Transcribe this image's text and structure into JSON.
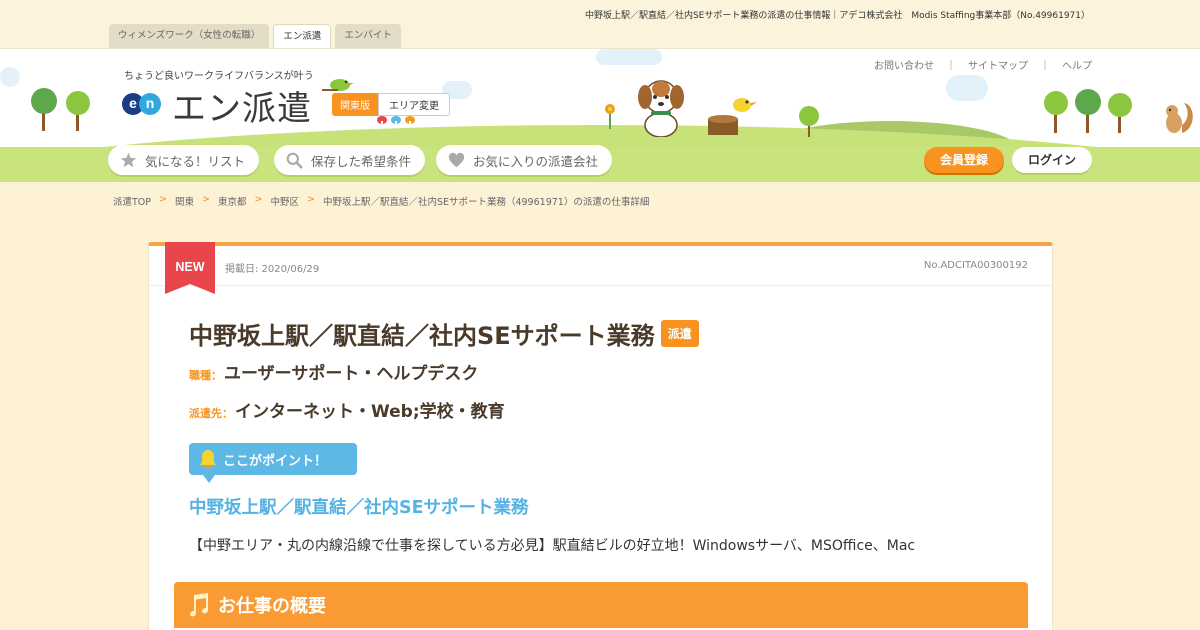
{
  "page_title": "中野坂上駅／駅直結／社内SEサポート業務の派遣の仕事情報｜アデコ株式会社　Modis Staffing事業本部（No.49961971）",
  "tabs": [
    {
      "label": "ウィメンズワーク（女性の転職）",
      "active": false
    },
    {
      "label": "エン派遣",
      "active": true
    },
    {
      "label": "エンバイト",
      "active": false
    }
  ],
  "header": {
    "tagline": "ちょうど良いワークライフバランスが叶う",
    "logo_en": [
      "e",
      "n"
    ],
    "logo_text": "エン派遣",
    "region_badge": "関東版",
    "region_change": "エリア変更",
    "util_links": [
      "お問い合わせ",
      "｜",
      "サイトマップ",
      "｜",
      "ヘルプ"
    ],
    "nav": [
      {
        "label": "気になる！リスト",
        "icon": "star-icon"
      },
      {
        "label": "保存した希望条件",
        "icon": "search-icon"
      },
      {
        "label": "お気に入りの派遣会社",
        "icon": "heart-icon"
      }
    ],
    "register_label": "会員登録",
    "login_label": "ログイン"
  },
  "breadcrumb": [
    "派遣TOP",
    "関東",
    "東京都",
    "中野区",
    "中野坂上駅／駅直結／社内SEサポート業務（49961971）の派遣の仕事詳細"
  ],
  "breadcrumb_sep": ">",
  "job": {
    "new_label": "NEW",
    "published": "掲載日: 2020/06/29",
    "number": "No.ADCITA00300192",
    "title": "中野坂上駅／駅直結／社内SEサポート業務",
    "type_badge": "派遣",
    "occupation_label": "職種：",
    "occupation": "ユーザーサポート・ヘルプデスク",
    "dispatch_label": "派遣先：",
    "dispatch": "インターネット・Web;学校・教育",
    "point_label": "ここがポイント！",
    "point_heading": "中野坂上駅／駅直結／社内SEサポート業務",
    "point_text": "【中野エリア・丸の内線沿線で仕事を探している方必見】駅直結ビルの好立地！Windowsサーバ、MSOffice、Mac",
    "section_title": "お仕事の概要"
  },
  "colors": {
    "accent_orange": "#f7931e",
    "point_blue": "#5db8e6",
    "new_red": "#e8464a",
    "hill_green": "#c8e27a"
  }
}
